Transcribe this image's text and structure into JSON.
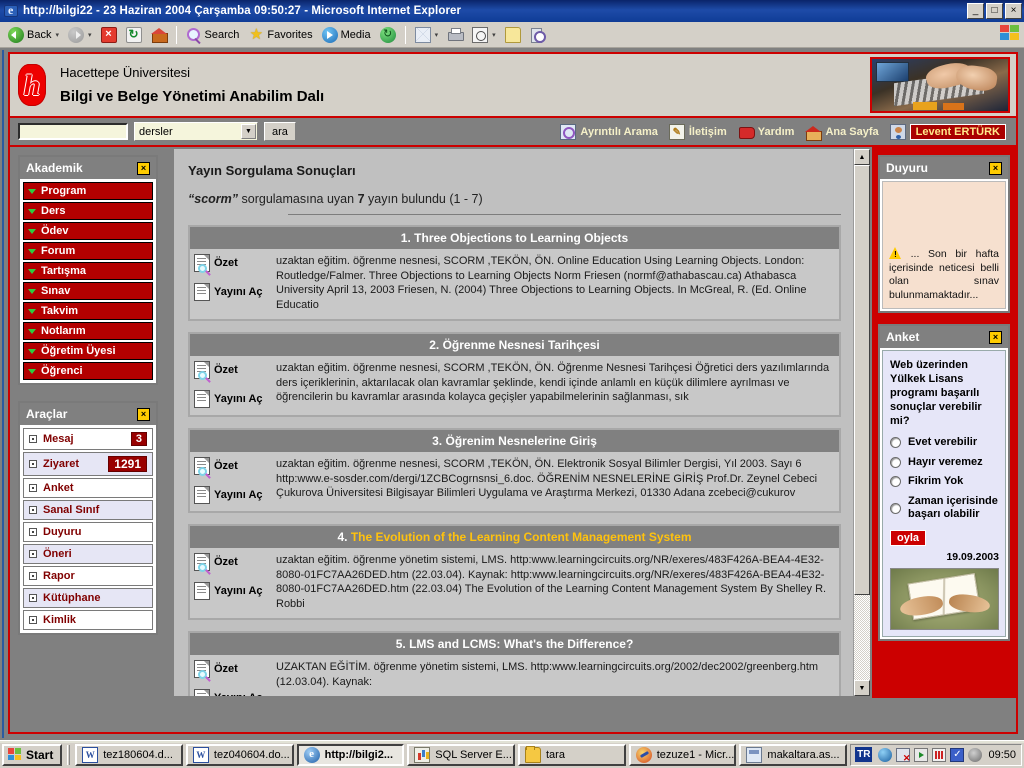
{
  "window": {
    "title": "http://bilgi22 - 23 Haziran 2004 Çarşamba 09:50:27 - Microsoft Internet Explorer",
    "minimize": "_",
    "maximize": "□",
    "close": "×"
  },
  "toolbar": {
    "back": "Back",
    "forward": "",
    "stop": "",
    "refresh": "",
    "home": "",
    "search": "Search",
    "favorites": "Favorites",
    "media": "Media",
    "history": "",
    "mail": "",
    "print": "",
    "edit": "",
    "discuss": "",
    "research": "",
    "dropdown_arrow": "▾"
  },
  "site": {
    "university": "Hacettepe Üniversitesi",
    "department": "Bilgi ve Belge Yönetimi Anabilim Dalı"
  },
  "search_bar": {
    "query_value": "",
    "scope_selected": "dersler",
    "submit_label": "ara",
    "arrow": "▼"
  },
  "nav": {
    "links": [
      {
        "label": "Ayrıntılı Arama",
        "icon": "magnifier-icon"
      },
      {
        "label": "İletişim",
        "icon": "note-icon"
      },
      {
        "label": "Yardım",
        "icon": "book-icon"
      },
      {
        "label": "Ana Sayfa",
        "icon": "home-icon"
      }
    ],
    "user": "Levent ERTÜRK"
  },
  "sidebar_left": {
    "academic": {
      "title": "Akademik",
      "close": "×",
      "items": [
        {
          "label": "Program"
        },
        {
          "label": "Ders"
        },
        {
          "label": "Ödev"
        },
        {
          "label": "Forum"
        },
        {
          "label": "Tartışma"
        },
        {
          "label": "Sınav"
        },
        {
          "label": "Takvim"
        },
        {
          "label": "Notlarım"
        },
        {
          "label": "Öğretim Üyesi"
        },
        {
          "label": "Öğrenci"
        }
      ]
    },
    "tools": {
      "title": "Araçlar",
      "close": "×",
      "items": [
        {
          "label": "Mesaj",
          "badge": "3"
        },
        {
          "label": "Ziyaret",
          "badge": "1291"
        },
        {
          "label": "Anket",
          "badge": ""
        },
        {
          "label": "Sanal Sınıf",
          "badge": ""
        },
        {
          "label": "Duyuru",
          "badge": ""
        },
        {
          "label": "Öneri",
          "badge": ""
        },
        {
          "label": "Rapor",
          "badge": ""
        },
        {
          "label": "Kütüphane",
          "badge": ""
        },
        {
          "label": "Kimlik",
          "badge": ""
        }
      ]
    }
  },
  "main": {
    "page_title": "Yayın Sorgulama Sonuçları",
    "summary": {
      "query": "“scorm”",
      "text_before": "sorgulamasına uyan",
      "count": "7",
      "text_after": "yayın bulundu (1 - 7)"
    },
    "action_abstract": "Özet",
    "action_open": "Yayını Aç",
    "results": [
      {
        "number": "1.",
        "title": "Three Objections to Learning Objects",
        "highlighted": false,
        "abstract": "uzaktan eğitim. öğrenme nesnesi, SCORM ,TEKÖN, ÖN. Online Education Using Learning Objects. London: Routledge/Falmer. Three Objections to Learning Objects Norm Friesen (normf@athabascau.ca) Athabasca University April 13, 2003 Friesen, N. (2004) Three Objections to Learning Objects. In McGreal, R. (Ed. Online Educatio"
      },
      {
        "number": "2.",
        "title": "Öğrenme Nesnesi Tarihçesi",
        "highlighted": false,
        "abstract": "uzaktan eğitim. öğrenme nesnesi, SCORM ,TEKÖN, ÖN. Öğrenme Nesnesi Tarihçesi Öğretici ders yazılımlarında ders içeriklerinin, aktarılacak olan kavramlar şeklinde, kendi içinde anlamlı en küçük dilimlere ayrılması ve öğrencilerin bu kavramlar arasında kolayca geçişler yapabilmelerinin sağlanması, sık"
      },
      {
        "number": "3.",
        "title": "Öğrenim Nesnelerine Giriş",
        "highlighted": false,
        "abstract": "uzaktan eğitim. öğrenme nesnesi, SCORM ,TEKÖN, ÖN. Elektronik Sosyal Bilimler Dergisi, Yıl 2003. Sayı 6 http:www.e-sosder.com/dergi/1ZCBCogrnsnsi_6.doc. ÖĞRENİM NESNELERİNE GİRİŞ Prof.Dr. Zeynel Cebeci Çukurova Üniversitesi Bilgisayar Bilimleri Uygulama ve Araştırma Merkezi, 01330 Adana zcebeci@cukurov"
      },
      {
        "number": "4.",
        "title": "The Evolution of the Learning Content Management System",
        "highlighted": true,
        "abstract": "uzaktan eğitim. öğrenme yönetim sistemi, LMS. http:www.learningcircuits.org/NR/exeres/483F426A-BEA4-4E32-8080-01FC7AA26DED.htm (22.03.04). Kaynak: http:www.learningcircuits.org/NR/exeres/483F426A-BEA4-4E32-8080-01FC7AA26DED.htm (22.03.04) The Evolution of the Learning Content Management System By Shelley R. Robbi"
      },
      {
        "number": "5.",
        "title": "LMS and LCMS: What's the Difference?",
        "highlighted": false,
        "abstract": "UZAKTAN EĞİTİM. öğrenme yönetim sistemi, LMS. http:www.learningcircuits.org/2002/dec2002/greenberg.htm (12.03.04). Kaynak:"
      }
    ]
  },
  "sidebar_right": {
    "announcement": {
      "title": "Duyuru",
      "close": "×",
      "text": "... Son bir hafta içerisinde neticesi belli olan sınav bulunmamaktadır..."
    },
    "poll": {
      "title": "Anket",
      "close": "×",
      "question": "Web üzerinden Yülkek Lisans programı başarılı sonuçlar verebilir mi?",
      "options": [
        "Evet verebilir",
        "Hayır veremez",
        "Fikrim Yok",
        "Zaman içerisinde başarı olabilir"
      ],
      "vote_label": "oyla",
      "date": "19.09.2003"
    }
  },
  "taskbar": {
    "start": "Start",
    "items": [
      {
        "label": "tez180604.d...",
        "icon": "word-icon",
        "active": false
      },
      {
        "label": "tez040604.do...",
        "icon": "word-icon",
        "active": false
      },
      {
        "label": "http://bilgi2...",
        "icon": "ie-icon",
        "active": true
      },
      {
        "label": "SQL Server E...",
        "icon": "sql-icon",
        "active": false
      },
      {
        "label": "tara",
        "icon": "folder-icon",
        "active": false
      },
      {
        "label": "tezuze1 - Micr...",
        "icon": "netscape-icon",
        "active": false
      },
      {
        "label": "makaltara.as...",
        "icon": "file-icon",
        "active": false
      }
    ],
    "language": "TR",
    "clock": "09:50"
  }
}
